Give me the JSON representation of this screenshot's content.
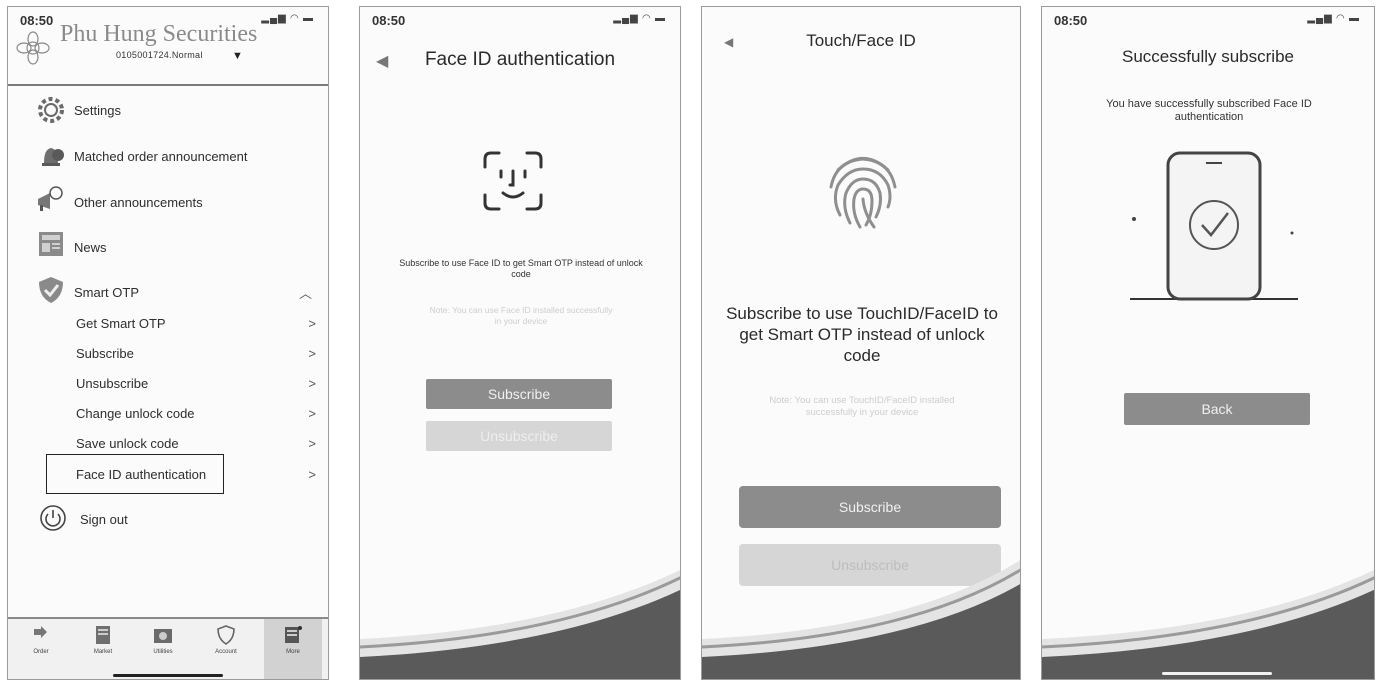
{
  "status": {
    "time": "08:50"
  },
  "screen1": {
    "brand": "Phu Hung Securities",
    "account": "0105001724.Normal",
    "menu": [
      {
        "label": "Settings",
        "icon": "gear-icon"
      },
      {
        "label": "Matched order announcement",
        "icon": "bell-icon"
      },
      {
        "label": "Other announcements",
        "icon": "megaphone-icon"
      },
      {
        "label": "News",
        "icon": "newspaper-icon"
      },
      {
        "label": "Smart OTP",
        "icon": "shield-check-icon"
      }
    ],
    "submenu": [
      {
        "label": "Get Smart OTP"
      },
      {
        "label": "Subscribe"
      },
      {
        "label": "Unsubscribe"
      },
      {
        "label": "Change unlock code"
      },
      {
        "label": "Save unlock code"
      },
      {
        "label": "Face ID authentication"
      }
    ],
    "sign_out": "Sign out",
    "tabs": [
      {
        "label": "Order",
        "icon": "order-icon"
      },
      {
        "label": "Market",
        "icon": "market-icon"
      },
      {
        "label": "Utilities",
        "icon": "utilities-icon"
      },
      {
        "label": "Account",
        "icon": "account-icon"
      },
      {
        "label": "More",
        "icon": "more-icon"
      }
    ]
  },
  "screen2": {
    "title": "Face ID authentication",
    "desc": "Subscribe to use Face ID to get Smart OTP instead of unlock code",
    "note": "Note: You can use Face ID installed successfully in your device",
    "subscribe": "Subscribe",
    "unsubscribe": "Unsubscribe"
  },
  "screen3": {
    "title": "Touch/Face ID",
    "desc": "Subscribe to use TouchID/FaceID to get Smart OTP instead of unlock code",
    "note": "Note: You can use TouchID/FaceID installed successfully in your device",
    "subscribe": "Subscribe",
    "unsubscribe": "Unsubscribe"
  },
  "screen4": {
    "title": "Successfully subscribe",
    "message": "You have successfully subscribed Face ID authentication",
    "back": "Back"
  }
}
